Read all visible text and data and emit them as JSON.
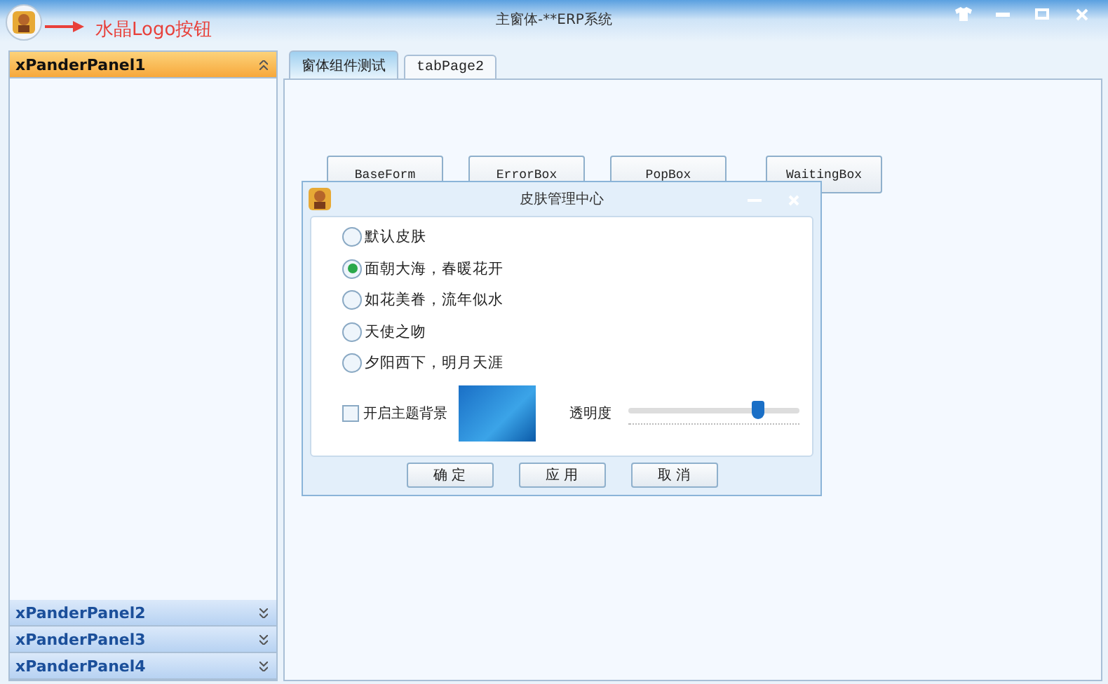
{
  "window": {
    "title": "主窗体-**ERP系统",
    "annotation": "水晶Logo按钮"
  },
  "sidebar": {
    "panels": [
      {
        "title": "xPanderPanel1",
        "expanded": true
      },
      {
        "title": "xPanderPanel2",
        "expanded": false
      },
      {
        "title": "xPanderPanel3",
        "expanded": false
      },
      {
        "title": "xPanderPanel4",
        "expanded": false
      }
    ]
  },
  "tabs": [
    {
      "label": "窗体组件测试",
      "selected": true
    },
    {
      "label": "tabPage2",
      "selected": false
    }
  ],
  "buttons": [
    "BaseForm",
    "ErrorBox",
    "PopBox",
    "WaitingBox"
  ],
  "dialog": {
    "title": "皮肤管理中心",
    "skins": [
      {
        "label": "默认皮肤",
        "selected": false
      },
      {
        "label": "面朝大海，春暖花开",
        "selected": true
      },
      {
        "label": "如花美眷，流年似水",
        "selected": false
      },
      {
        "label": "天使之吻",
        "selected": false
      },
      {
        "label": "夕阳西下，明月天涯",
        "selected": false
      }
    ],
    "theme_background": {
      "label": "开启主题背景",
      "checked": false
    },
    "opacity": {
      "label": "透明度",
      "level": 0.77
    },
    "buttons": [
      "确 定",
      "应 用",
      "取 消"
    ]
  }
}
